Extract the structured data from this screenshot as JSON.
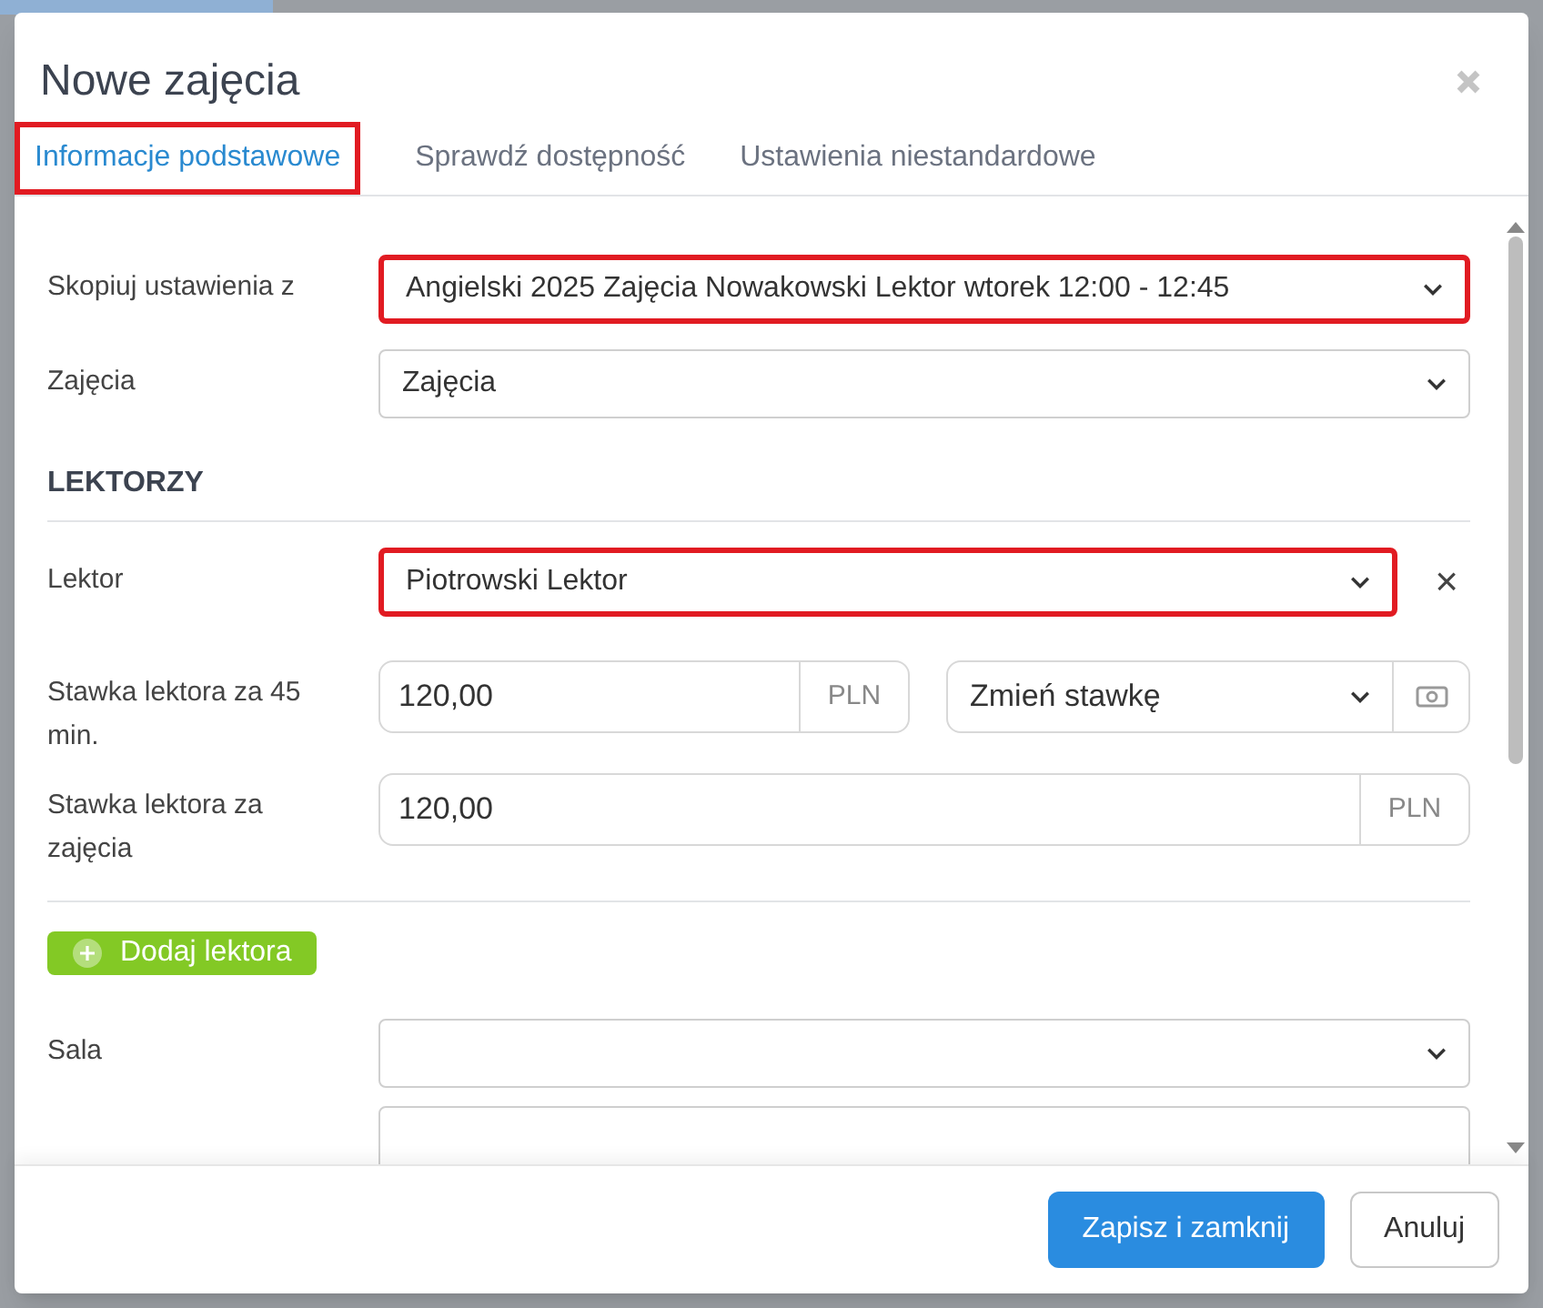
{
  "dialog": {
    "title": "Nowe zajęcia"
  },
  "tabs": [
    {
      "label": "Informacje podstawowe",
      "selected": true,
      "highlighted": true
    },
    {
      "label": "Sprawdź dostępność",
      "selected": false,
      "highlighted": false
    },
    {
      "label": "Ustawienia niestandardowe",
      "selected": false,
      "highlighted": false
    }
  ],
  "copy_settings": {
    "label": "Skopiuj ustawienia z",
    "value": "Angielski 2025 Zajęcia Nowakowski Lektor wtorek 12:00 - 12:45",
    "highlighted": true
  },
  "class_type": {
    "label": "Zajęcia",
    "value": "Zajęcia",
    "highlighted": false
  },
  "teachers_section": {
    "heading": "LEKTORZY",
    "teacher": {
      "label": "Lektor",
      "value": "Piotrowski Lektor",
      "highlighted": true,
      "remove": "×"
    },
    "rate_45": {
      "label": "Stawka lektora za 45 min.",
      "value": "120,00",
      "unit": "PLN",
      "change_select": "Zmień stawkę"
    },
    "rate_class": {
      "label": "Stawka lektora za zajęcia",
      "value": "120,00",
      "unit": "PLN"
    },
    "add_button": "Dodaj lektora"
  },
  "room": {
    "label": "Sala"
  },
  "footer": {
    "save": "Zapisz i zamknij",
    "cancel": "Anuluj"
  }
}
